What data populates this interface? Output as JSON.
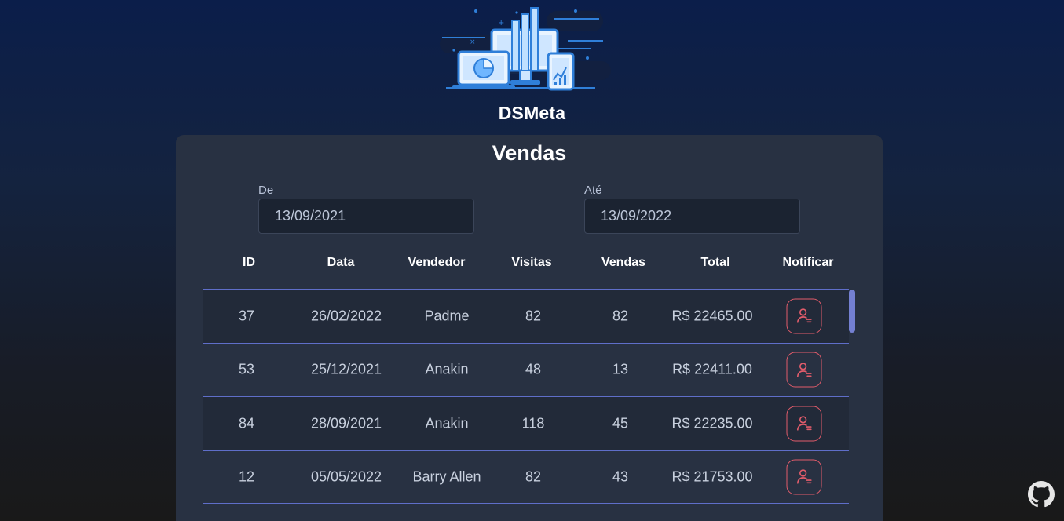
{
  "brand": "DSMeta",
  "card": {
    "title": "Vendas",
    "from": {
      "label": "De",
      "value": "13/09/2021"
    },
    "to": {
      "label": "Até",
      "value": "13/09/2022"
    }
  },
  "table": {
    "headers": [
      "ID",
      "Data",
      "Vendedor",
      "Visitas",
      "Vendas",
      "Total",
      "Notificar"
    ],
    "rows": [
      {
        "id": "37",
        "date": "26/02/2022",
        "seller": "Padme",
        "visits": "82",
        "sales": "82",
        "total": "R$ 22465.00"
      },
      {
        "id": "53",
        "date": "25/12/2021",
        "seller": "Anakin",
        "visits": "48",
        "sales": "13",
        "total": "R$ 22411.00"
      },
      {
        "id": "84",
        "date": "28/09/2021",
        "seller": "Anakin",
        "visits": "118",
        "sales": "45",
        "total": "R$ 22235.00"
      },
      {
        "id": "12",
        "date": "05/05/2022",
        "seller": "Barry Allen",
        "visits": "82",
        "sales": "43",
        "total": "R$ 21753.00"
      }
    ]
  },
  "icons": {
    "logo": "dashboard-illustration-icon",
    "notify": "notify-user-icon",
    "github": "github-icon"
  },
  "colors": {
    "card_bg": "#283142",
    "row_border": "#5f6ec9",
    "notify_accent": "#e25c6b",
    "scroll_thumb": "#7480d2"
  }
}
